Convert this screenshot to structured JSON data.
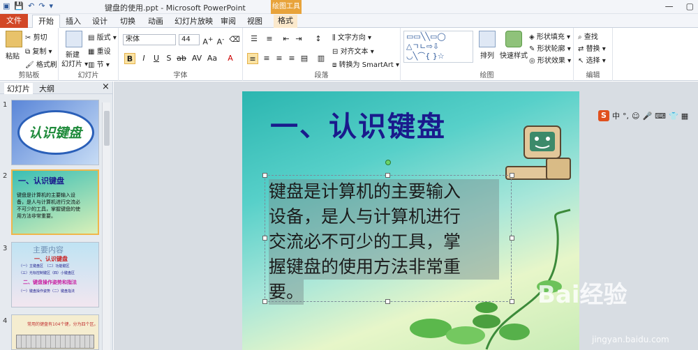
{
  "window": {
    "title": "键盘的使用.ppt - Microsoft PowerPoint",
    "context_tab": "绘图工具",
    "minimize": "—",
    "maximize": "▢"
  },
  "tabs": [
    "文件",
    "开始",
    "插入",
    "设计",
    "切换",
    "动画",
    "幻灯片放映",
    "审阅",
    "视图",
    "格式"
  ],
  "ribbon": {
    "clipboard": {
      "label": "剪贴板",
      "paste": "粘贴",
      "cut": "剪切",
      "copy": "复制 ▾",
      "format_painter": "格式刷"
    },
    "slides": {
      "label": "幻灯片",
      "new_slide": "新建",
      "new_slide2": "幻灯片 ▾",
      "layout": "版式 ▾",
      "reset": "重设",
      "section": "节 ▾"
    },
    "font": {
      "label": "字体",
      "font_name": "宋体",
      "font_size": "44"
    },
    "paragraph": {
      "label": "段落",
      "text_direction": "文字方向 ▾",
      "align_text": "对齐文本 ▾",
      "smartart": "转换为 SmartArt ▾"
    },
    "drawing": {
      "label": "绘图",
      "arrange": "排列",
      "quick_styles": "快速样式",
      "shape_fill": "形状填充 ▾",
      "shape_outline": "形状轮廓 ▾",
      "shape_effects": "形状效果 ▾"
    },
    "editing": {
      "label": "编辑",
      "find": "查找",
      "replace": "替换 ▾",
      "select": "选择 ▾"
    }
  },
  "panel": {
    "tab_slides": "幻灯片",
    "tab_outline": "大纲",
    "close": "×",
    "thumbnails": [
      {
        "num": "1",
        "title": "认识键盘"
      },
      {
        "num": "2",
        "title": "一、认识键盘",
        "text": "键盘是计算机的主要输入设备，是人与计算机进行交流必不可少的工具，掌握键盘的使用方法非常重要。"
      },
      {
        "num": "3",
        "title": "主要内容",
        "lines": [
          "一、认识键盘",
          "（一）主键盘区　（二）功能键区",
          "（三）光标控制键区（四）小键盘区",
          "二、键盘操作姿势和指法",
          "（一）键盘操作姿势（二）键盘指法"
        ]
      },
      {
        "num": "4",
        "text": "常用的键盘有104个键，分为四个区。"
      }
    ]
  },
  "slide": {
    "title": "一、认识键盘",
    "body_lines": [
      "键盘是计算机的主要输入",
      "设备，是人与计算机进行",
      "交流必不可少的工具，掌",
      "握键盘的使用方法非常重",
      "要。"
    ]
  },
  "ime": {
    "lang": "中",
    "punct": "°,"
  },
  "watermark": {
    "brand": "Bai经验",
    "url": "jingyan.baidu.com"
  }
}
